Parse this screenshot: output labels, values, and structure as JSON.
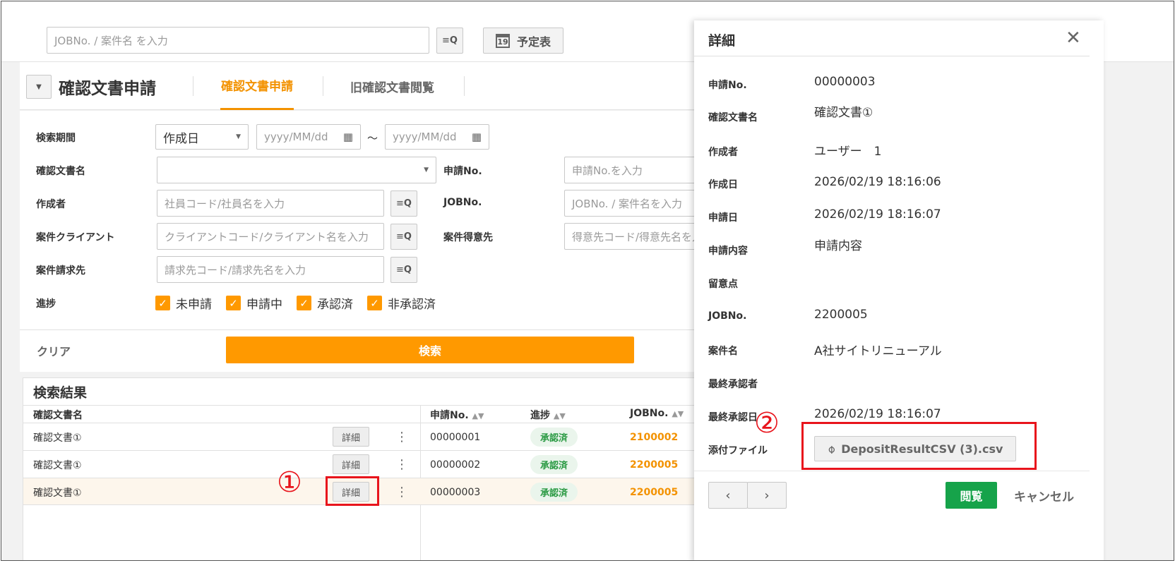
{
  "topbar": {
    "search_placeholder": "JOBNo. / 案件名 を入力",
    "schedule_label": "予定表",
    "calendar_day": "19"
  },
  "header": {
    "title": "確認文書申請",
    "tabs": [
      "確認文書申請",
      "旧確認文書閲覧"
    ]
  },
  "form": {
    "period_label": "検索期間",
    "period_select": "作成日",
    "date_placeholder": "yyyy/MM/dd",
    "range_sep": "～",
    "doc_name_label": "確認文書名",
    "app_no_label": "申請No.",
    "app_no_placeholder": "申請No.を入力",
    "creator_label": "作成者",
    "creator_placeholder": "社員コード/社員名を入力",
    "jobno_label": "JOBNo.",
    "jobno_placeholder": "JOBNo. / 案件名を入力",
    "client_label": "案件クライアント",
    "client_placeholder": "クライアントコード/クライアント名を入力",
    "customer_label": "案件得意先",
    "customer_placeholder": "得意先コード/得意先名を入力",
    "billing_label": "案件請求先",
    "billing_placeholder": "請求先コード/請求先名を入力",
    "progress_label": "進捗",
    "progress_options": [
      "未申請",
      "申請中",
      "承認済",
      "非承認済"
    ],
    "clear_label": "クリア",
    "search_label": "検索"
  },
  "results": {
    "title": "検索結果",
    "columns": [
      "確認文書名",
      "申請No.",
      "進捗",
      "JOBNo."
    ],
    "detail_label": "詳細",
    "rows": [
      {
        "name": "確認文書①",
        "no": "00000001",
        "status": "承認済",
        "job": "2100002"
      },
      {
        "name": "確認文書①",
        "no": "00000002",
        "status": "承認済",
        "job": "2200005"
      },
      {
        "name": "確認文書①",
        "no": "00000003",
        "status": "承認済",
        "job": "2200005"
      }
    ]
  },
  "panel": {
    "title": "詳細",
    "fields": [
      {
        "label": "申請No.",
        "value": "00000003"
      },
      {
        "label": "確認文書名",
        "value": "確認文書①"
      },
      {
        "label": "作成者",
        "value": "ユーザー　1"
      },
      {
        "label": "作成日",
        "value": "2026/02/19 18:16:06"
      },
      {
        "label": "申請日",
        "value": "2026/02/19 18:16:07"
      },
      {
        "label": "申請内容",
        "value": "申請内容"
      },
      {
        "label": "留意点",
        "value": ""
      },
      {
        "label": "JOBNo.",
        "value": "2200005"
      },
      {
        "label": "案件名",
        "value": "A社サイトリニューアル"
      },
      {
        "label": "最終承認者",
        "value": ""
      },
      {
        "label": "最終承認日",
        "value": "2026/02/19 18:16:07"
      },
      {
        "label": "添付ファイル",
        "value": ""
      }
    ],
    "attachment": "DepositResultCSV (3).csv",
    "view_label": "閲覧",
    "cancel_label": "キャンセル"
  },
  "annotations": [
    "①",
    "②"
  ],
  "colors": {
    "accent": "#f39200",
    "green": "#16a34a",
    "highlight": "#e8141c"
  }
}
